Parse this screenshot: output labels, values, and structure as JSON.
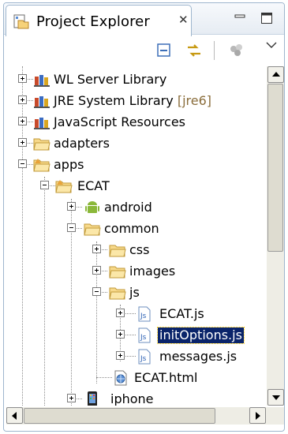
{
  "view": {
    "tab_title": "Project Explorer",
    "tab_close": "✕",
    "tab_icon": "project-explorer-icon"
  },
  "toolbar": {
    "icons": [
      "collapse-all-icon",
      "link-with-editor-icon",
      "filter-icon",
      "view-menu-icon"
    ]
  },
  "tree": {
    "items": [
      {
        "label": "WL Server Library",
        "decoration": "",
        "icon": "library-icon",
        "expander": "plus"
      },
      {
        "label": "JRE System Library",
        "decoration": "[jre6]",
        "icon": "library-icon",
        "expander": "plus"
      },
      {
        "label": "JavaScript Resources",
        "decoration": "",
        "icon": "library-icon",
        "expander": "plus"
      },
      {
        "label": "adapters",
        "decoration": "",
        "icon": "folder-icon",
        "expander": "plus"
      },
      {
        "label": "apps",
        "decoration": "",
        "icon": "apps-folder-icon",
        "expander": "minus"
      },
      {
        "label": "ECAT",
        "decoration": "",
        "icon": "apps-folder-icon",
        "expander": "minus"
      },
      {
        "label": "android",
        "decoration": "",
        "icon": "android-icon",
        "expander": "plus"
      },
      {
        "label": "common",
        "decoration": "",
        "icon": "folder-icon",
        "expander": "minus"
      },
      {
        "label": "css",
        "decoration": "",
        "icon": "folder-icon",
        "expander": "plus"
      },
      {
        "label": "images",
        "decoration": "",
        "icon": "folder-icon",
        "expander": "plus"
      },
      {
        "label": "js",
        "decoration": "",
        "icon": "folder-icon",
        "expander": "minus"
      },
      {
        "label": "ECAT.js",
        "decoration": "",
        "icon": "js-file-icon",
        "expander": "plus"
      },
      {
        "label": "initOptions.js",
        "decoration": "",
        "icon": "js-file-icon",
        "expander": "plus",
        "selected": true
      },
      {
        "label": "messages.js",
        "decoration": "",
        "icon": "js-file-icon",
        "expander": "plus"
      },
      {
        "label": "ECAT.html",
        "decoration": "",
        "icon": "html-file-icon",
        "expander": "none"
      },
      {
        "label": "iphone",
        "decoration": "",
        "icon": "iphone-icon",
        "expander": "plus"
      }
    ]
  },
  "scroll": {
    "vertical_thumb_fraction": 0.55,
    "horizontal_thumb_fraction": 0.85
  }
}
